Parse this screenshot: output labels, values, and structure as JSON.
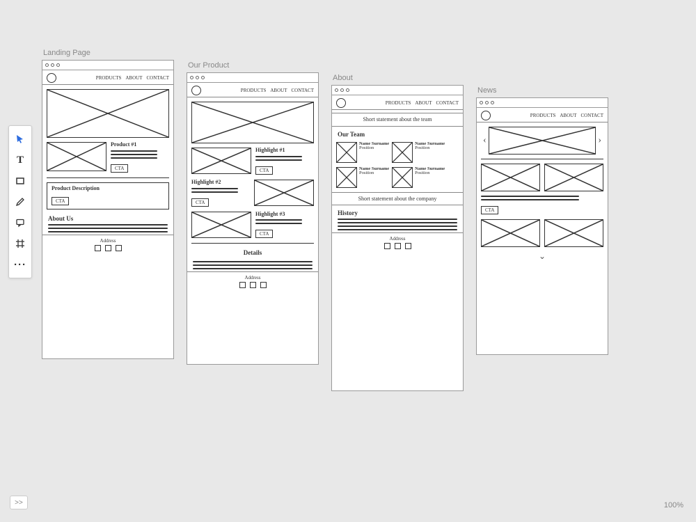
{
  "toolbar": {
    "tools": [
      "pointer",
      "text",
      "rectangle",
      "pencil",
      "comment",
      "artboard",
      "more"
    ]
  },
  "zoom": "100%",
  "expand_label": ">>",
  "nav": {
    "items": [
      "Products",
      "About",
      "Contact"
    ]
  },
  "artboards": {
    "landing": {
      "label": "Landing Page",
      "product1": "Product #1",
      "cta": "CTA",
      "desc_title": "Product Description",
      "about_title": "About Us",
      "footer": "Address"
    },
    "product": {
      "label": "Our Product",
      "h1": "Highlight #1",
      "h2": "Highlight #2",
      "h3": "Highlight #3",
      "cta": "CTA",
      "details": "Details",
      "footer": "Address"
    },
    "about": {
      "label": "About",
      "statement_team": "Short statement about the team",
      "our_team": "Our Team",
      "member": "Name Surname",
      "member_role": "Position",
      "statement_company": "Short statement about the company",
      "history": "History",
      "footer": "Address"
    },
    "news": {
      "label": "News",
      "cta": "CTA"
    }
  }
}
